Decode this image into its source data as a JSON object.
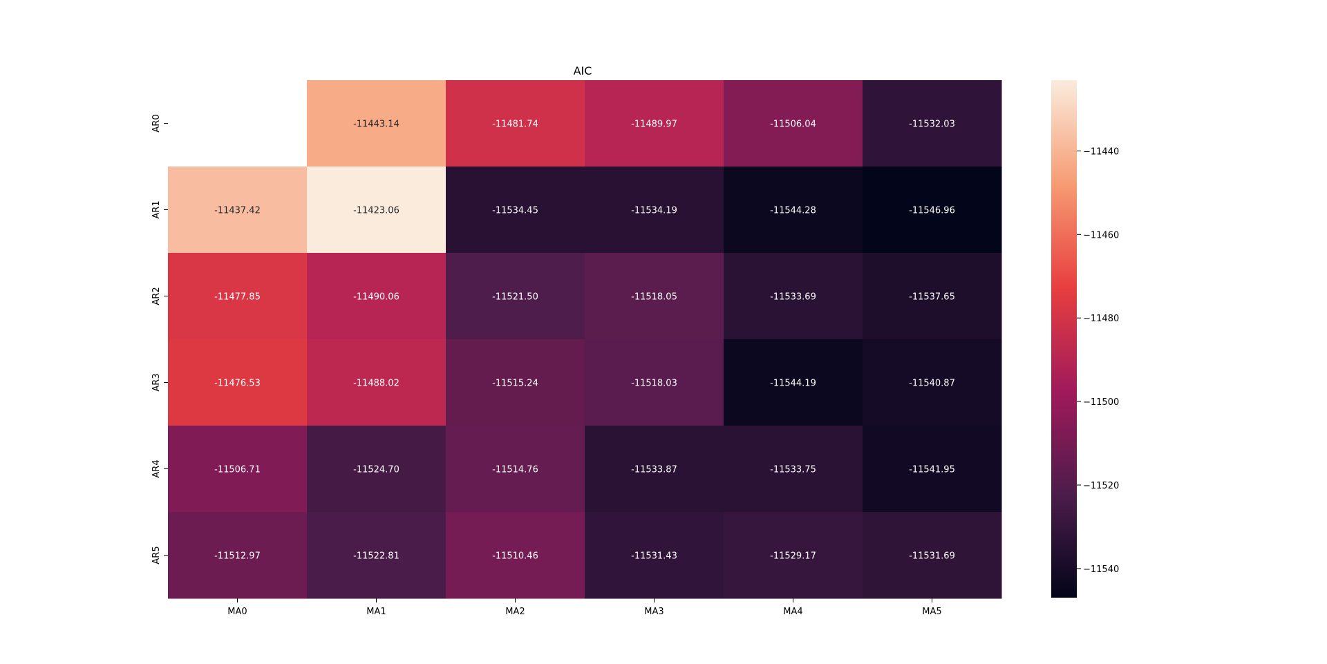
{
  "chart_data": {
    "type": "heatmap",
    "title": "AIC",
    "xlabel": "",
    "ylabel": "",
    "x_categories": [
      "MA0",
      "MA1",
      "MA2",
      "MA3",
      "MA4",
      "MA5"
    ],
    "y_categories": [
      "AR0",
      "AR1",
      "AR2",
      "AR3",
      "AR4",
      "AR5"
    ],
    "values": [
      [
        null,
        -11443.14,
        -11481.74,
        -11489.97,
        -11506.04,
        -11532.03
      ],
      [
        -11437.42,
        -11423.06,
        -11534.45,
        -11534.19,
        -11544.28,
        -11546.96
      ],
      [
        -11477.85,
        -11490.06,
        -11521.5,
        -11518.05,
        -11533.69,
        -11537.65
      ],
      [
        -11476.53,
        -11488.02,
        -11515.24,
        -11518.03,
        -11544.19,
        -11540.87
      ],
      [
        -11506.71,
        -11524.7,
        -11514.76,
        -11533.87,
        -11533.75,
        -11541.95
      ],
      [
        -11512.97,
        -11522.81,
        -11510.46,
        -11531.43,
        -11529.17,
        -11531.69
      ]
    ],
    "cell_labels": [
      [
        "",
        "-11443.14",
        "-11481.74",
        "-11489.97",
        "-11506.04",
        "-11532.03"
      ],
      [
        "-11437.42",
        "-11423.06",
        "-11534.45",
        "-11534.19",
        "-11544.28",
        "-11546.96"
      ],
      [
        "-11477.85",
        "-11490.06",
        "-11521.50",
        "-11518.05",
        "-11533.69",
        "-11537.65"
      ],
      [
        "-11476.53",
        "-11488.02",
        "-11515.24",
        "-11518.03",
        "-11544.19",
        "-11540.87"
      ],
      [
        "-11506.71",
        "-11524.70",
        "-11514.76",
        "-11533.87",
        "-11533.75",
        "-11541.95"
      ],
      [
        "-11512.97",
        "-11522.81",
        "-11510.46",
        "-11531.43",
        "-11529.17",
        "-11531.69"
      ]
    ],
    "colorbar": {
      "vmin": -11546.96,
      "vmax": -11423.06,
      "ticks": [
        -11440,
        -11460,
        -11480,
        -11500,
        -11520,
        -11540
      ],
      "tick_labels": [
        "−11440",
        "−11460",
        "−11480",
        "−11500",
        "−11520",
        "−11540"
      ]
    },
    "colormap": "rocket",
    "colormap_stops": [
      "#03051a",
      "#4c1d4b",
      "#a11a5b",
      "#e83f3f",
      "#f69c73",
      "#faebdd"
    ],
    "grid": false,
    "legend": "colorbar right"
  }
}
